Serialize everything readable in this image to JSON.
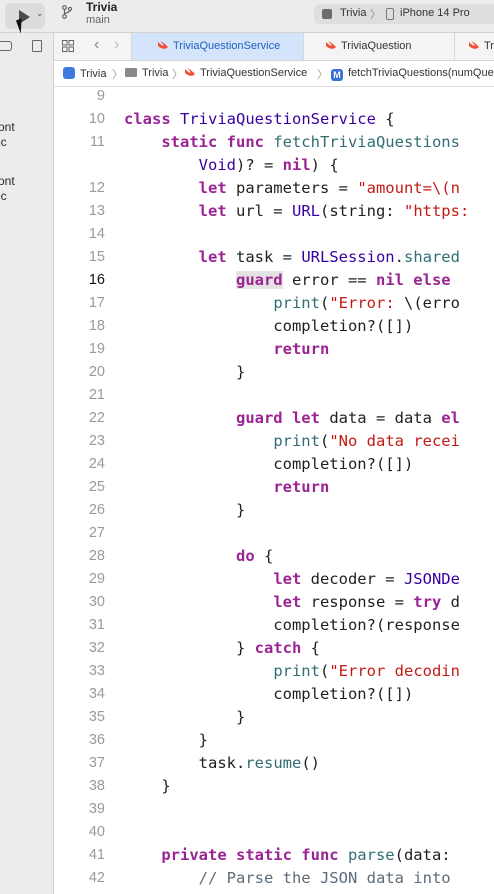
{
  "toolbar": {
    "project_name": "Trivia",
    "branch_name": "main",
    "scheme_name": "Trivia",
    "scheme_separator": "〉",
    "device_name": "iPhone 14 Pro"
  },
  "left_panel": {
    "fragments": [
      "ont",
      "ic",
      "ont",
      "ic"
    ]
  },
  "tabs": [
    {
      "label": "TriviaQuestionService",
      "active": true
    },
    {
      "label": "TriviaQuestion",
      "active": false
    },
    {
      "label": "Tr",
      "active": false
    }
  ],
  "breadcrumb": {
    "items": [
      "Trivia",
      "Trivia",
      "TriviaQuestionService",
      "fetchTriviaQuestions(numQue"
    ],
    "separator": "〉"
  },
  "editor": {
    "current_line": "16",
    "lines": [
      {
        "n": "9",
        "t": [
          {
            "c": "tx",
            "s": ""
          }
        ]
      },
      {
        "n": "10",
        "t": [
          {
            "c": "kw",
            "s": "class "
          },
          {
            "c": "ty",
            "s": "TriviaQuestionService"
          },
          {
            "c": "tx",
            "s": " {"
          }
        ]
      },
      {
        "n": "11",
        "t": [
          {
            "c": "tx",
            "s": "    "
          },
          {
            "c": "kw",
            "s": "static func "
          },
          {
            "c": "fn",
            "s": "fetchTriviaQuestions"
          }
        ]
      },
      {
        "n": "",
        "t": [
          {
            "c": "tx",
            "s": "        "
          },
          {
            "c": "ty",
            "s": "Void"
          },
          {
            "c": "tx",
            "s": ")? = "
          },
          {
            "c": "kw",
            "s": "nil"
          },
          {
            "c": "tx",
            "s": ") {"
          }
        ]
      },
      {
        "n": "12",
        "t": [
          {
            "c": "tx",
            "s": "        "
          },
          {
            "c": "kw",
            "s": "let "
          },
          {
            "c": "tx",
            "s": "parameters = "
          },
          {
            "c": "st",
            "s": "\"amount=\\(n"
          }
        ]
      },
      {
        "n": "13",
        "t": [
          {
            "c": "tx",
            "s": "        "
          },
          {
            "c": "kw",
            "s": "let "
          },
          {
            "c": "tx",
            "s": "url = "
          },
          {
            "c": "ty",
            "s": "URL"
          },
          {
            "c": "tx",
            "s": "(string: "
          },
          {
            "c": "st",
            "s": "\"https:"
          }
        ]
      },
      {
        "n": "14",
        "t": [
          {
            "c": "tx",
            "s": ""
          }
        ]
      },
      {
        "n": "15",
        "t": [
          {
            "c": "tx",
            "s": "        "
          },
          {
            "c": "kw",
            "s": "let "
          },
          {
            "c": "tx",
            "s": "task = "
          },
          {
            "c": "ty",
            "s": "URLSession"
          },
          {
            "c": "tx",
            "s": "."
          },
          {
            "c": "fn",
            "s": "shared"
          }
        ]
      },
      {
        "n": "16",
        "t": [
          {
            "c": "tx",
            "s": "            "
          },
          {
            "c": "kw hl",
            "s": "guard"
          },
          {
            "c": "tx",
            "s": " error == "
          },
          {
            "c": "kw",
            "s": "nil else"
          }
        ]
      },
      {
        "n": "17",
        "t": [
          {
            "c": "tx",
            "s": "                "
          },
          {
            "c": "fn",
            "s": "print"
          },
          {
            "c": "tx",
            "s": "("
          },
          {
            "c": "st",
            "s": "\"Error: "
          },
          {
            "c": "tx",
            "s": "\\(erro"
          }
        ]
      },
      {
        "n": "18",
        "t": [
          {
            "c": "tx",
            "s": "                completion?([])"
          }
        ]
      },
      {
        "n": "19",
        "t": [
          {
            "c": "tx",
            "s": "                "
          },
          {
            "c": "kw",
            "s": "return"
          }
        ]
      },
      {
        "n": "20",
        "t": [
          {
            "c": "tx",
            "s": "            }"
          }
        ]
      },
      {
        "n": "21",
        "t": [
          {
            "c": "tx",
            "s": ""
          }
        ]
      },
      {
        "n": "22",
        "t": [
          {
            "c": "tx",
            "s": "            "
          },
          {
            "c": "kw",
            "s": "guard let "
          },
          {
            "c": "tx",
            "s": "data = data "
          },
          {
            "c": "kw",
            "s": "el"
          }
        ]
      },
      {
        "n": "23",
        "t": [
          {
            "c": "tx",
            "s": "                "
          },
          {
            "c": "fn",
            "s": "print"
          },
          {
            "c": "tx",
            "s": "("
          },
          {
            "c": "st",
            "s": "\"No data recei"
          }
        ]
      },
      {
        "n": "24",
        "t": [
          {
            "c": "tx",
            "s": "                completion?([])"
          }
        ]
      },
      {
        "n": "25",
        "t": [
          {
            "c": "tx",
            "s": "                "
          },
          {
            "c": "kw",
            "s": "return"
          }
        ]
      },
      {
        "n": "26",
        "t": [
          {
            "c": "tx",
            "s": "            }"
          }
        ]
      },
      {
        "n": "27",
        "t": [
          {
            "c": "tx",
            "s": ""
          }
        ]
      },
      {
        "n": "28",
        "t": [
          {
            "c": "tx",
            "s": "            "
          },
          {
            "c": "kw",
            "s": "do"
          },
          {
            "c": "tx",
            "s": " {"
          }
        ]
      },
      {
        "n": "29",
        "t": [
          {
            "c": "tx",
            "s": "                "
          },
          {
            "c": "kw",
            "s": "let "
          },
          {
            "c": "tx",
            "s": "decoder = "
          },
          {
            "c": "ty",
            "s": "JSONDe"
          }
        ]
      },
      {
        "n": "30",
        "t": [
          {
            "c": "tx",
            "s": "                "
          },
          {
            "c": "kw",
            "s": "let "
          },
          {
            "c": "tx",
            "s": "response = "
          },
          {
            "c": "kw",
            "s": "try "
          },
          {
            "c": "tx",
            "s": "d"
          }
        ]
      },
      {
        "n": "31",
        "t": [
          {
            "c": "tx",
            "s": "                completion?(response"
          }
        ]
      },
      {
        "n": "32",
        "t": [
          {
            "c": "tx",
            "s": "            } "
          },
          {
            "c": "kw",
            "s": "catch"
          },
          {
            "c": "tx",
            "s": " {"
          }
        ]
      },
      {
        "n": "33",
        "t": [
          {
            "c": "tx",
            "s": "                "
          },
          {
            "c": "fn",
            "s": "print"
          },
          {
            "c": "tx",
            "s": "("
          },
          {
            "c": "st",
            "s": "\"Error decodin"
          }
        ]
      },
      {
        "n": "34",
        "t": [
          {
            "c": "tx",
            "s": "                completion?([])"
          }
        ]
      },
      {
        "n": "35",
        "t": [
          {
            "c": "tx",
            "s": "            }"
          }
        ]
      },
      {
        "n": "36",
        "t": [
          {
            "c": "tx",
            "s": "        }"
          }
        ]
      },
      {
        "n": "37",
        "t": [
          {
            "c": "tx",
            "s": "        task."
          },
          {
            "c": "fn",
            "s": "resume"
          },
          {
            "c": "tx",
            "s": "()"
          }
        ]
      },
      {
        "n": "38",
        "t": [
          {
            "c": "tx",
            "s": "    }"
          }
        ]
      },
      {
        "n": "39",
        "t": [
          {
            "c": "tx",
            "s": ""
          }
        ]
      },
      {
        "n": "40",
        "t": [
          {
            "c": "tx",
            "s": ""
          }
        ]
      },
      {
        "n": "41",
        "t": [
          {
            "c": "tx",
            "s": "    "
          },
          {
            "c": "kw",
            "s": "private static func "
          },
          {
            "c": "fn",
            "s": "parse"
          },
          {
            "c": "tx",
            "s": "(data:"
          }
        ]
      },
      {
        "n": "42",
        "t": [
          {
            "c": "tx",
            "s": "        "
          },
          {
            "c": "cm",
            "s": "// Parse the JSON data into"
          }
        ]
      }
    ]
  },
  "colors": {
    "keyword": "#9b2393",
    "type": "#3900a0",
    "function": "#326d74",
    "string": "#c41a16",
    "comment": "#5d6c79",
    "active_tab": "#d4e5fb"
  }
}
